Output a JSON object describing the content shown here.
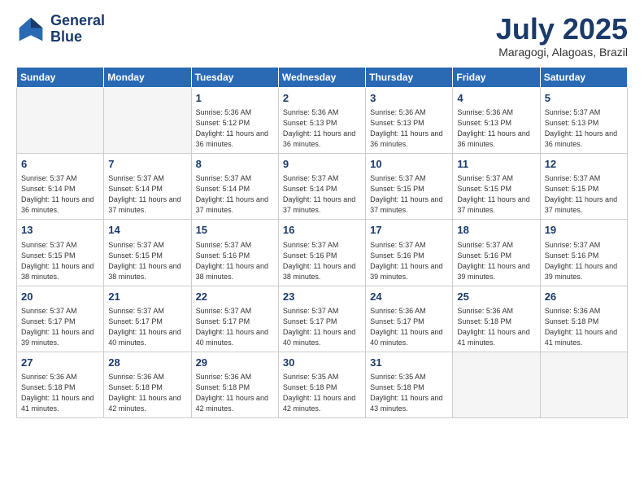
{
  "header": {
    "logo_line1": "General",
    "logo_line2": "Blue",
    "month": "July 2025",
    "location": "Maragogi, Alagoas, Brazil"
  },
  "weekdays": [
    "Sunday",
    "Monday",
    "Tuesday",
    "Wednesday",
    "Thursday",
    "Friday",
    "Saturday"
  ],
  "weeks": [
    [
      {
        "day": "",
        "info": ""
      },
      {
        "day": "",
        "info": ""
      },
      {
        "day": "1",
        "info": "Sunrise: 5:36 AM\nSunset: 5:12 PM\nDaylight: 11 hours and 36 minutes."
      },
      {
        "day": "2",
        "info": "Sunrise: 5:36 AM\nSunset: 5:13 PM\nDaylight: 11 hours and 36 minutes."
      },
      {
        "day": "3",
        "info": "Sunrise: 5:36 AM\nSunset: 5:13 PM\nDaylight: 11 hours and 36 minutes."
      },
      {
        "day": "4",
        "info": "Sunrise: 5:36 AM\nSunset: 5:13 PM\nDaylight: 11 hours and 36 minutes."
      },
      {
        "day": "5",
        "info": "Sunrise: 5:37 AM\nSunset: 5:13 PM\nDaylight: 11 hours and 36 minutes."
      }
    ],
    [
      {
        "day": "6",
        "info": "Sunrise: 5:37 AM\nSunset: 5:14 PM\nDaylight: 11 hours and 36 minutes."
      },
      {
        "day": "7",
        "info": "Sunrise: 5:37 AM\nSunset: 5:14 PM\nDaylight: 11 hours and 37 minutes."
      },
      {
        "day": "8",
        "info": "Sunrise: 5:37 AM\nSunset: 5:14 PM\nDaylight: 11 hours and 37 minutes."
      },
      {
        "day": "9",
        "info": "Sunrise: 5:37 AM\nSunset: 5:14 PM\nDaylight: 11 hours and 37 minutes."
      },
      {
        "day": "10",
        "info": "Sunrise: 5:37 AM\nSunset: 5:15 PM\nDaylight: 11 hours and 37 minutes."
      },
      {
        "day": "11",
        "info": "Sunrise: 5:37 AM\nSunset: 5:15 PM\nDaylight: 11 hours and 37 minutes."
      },
      {
        "day": "12",
        "info": "Sunrise: 5:37 AM\nSunset: 5:15 PM\nDaylight: 11 hours and 37 minutes."
      }
    ],
    [
      {
        "day": "13",
        "info": "Sunrise: 5:37 AM\nSunset: 5:15 PM\nDaylight: 11 hours and 38 minutes."
      },
      {
        "day": "14",
        "info": "Sunrise: 5:37 AM\nSunset: 5:15 PM\nDaylight: 11 hours and 38 minutes."
      },
      {
        "day": "15",
        "info": "Sunrise: 5:37 AM\nSunset: 5:16 PM\nDaylight: 11 hours and 38 minutes."
      },
      {
        "day": "16",
        "info": "Sunrise: 5:37 AM\nSunset: 5:16 PM\nDaylight: 11 hours and 38 minutes."
      },
      {
        "day": "17",
        "info": "Sunrise: 5:37 AM\nSunset: 5:16 PM\nDaylight: 11 hours and 39 minutes."
      },
      {
        "day": "18",
        "info": "Sunrise: 5:37 AM\nSunset: 5:16 PM\nDaylight: 11 hours and 39 minutes."
      },
      {
        "day": "19",
        "info": "Sunrise: 5:37 AM\nSunset: 5:16 PM\nDaylight: 11 hours and 39 minutes."
      }
    ],
    [
      {
        "day": "20",
        "info": "Sunrise: 5:37 AM\nSunset: 5:17 PM\nDaylight: 11 hours and 39 minutes."
      },
      {
        "day": "21",
        "info": "Sunrise: 5:37 AM\nSunset: 5:17 PM\nDaylight: 11 hours and 40 minutes."
      },
      {
        "day": "22",
        "info": "Sunrise: 5:37 AM\nSunset: 5:17 PM\nDaylight: 11 hours and 40 minutes."
      },
      {
        "day": "23",
        "info": "Sunrise: 5:37 AM\nSunset: 5:17 PM\nDaylight: 11 hours and 40 minutes."
      },
      {
        "day": "24",
        "info": "Sunrise: 5:36 AM\nSunset: 5:17 PM\nDaylight: 11 hours and 40 minutes."
      },
      {
        "day": "25",
        "info": "Sunrise: 5:36 AM\nSunset: 5:18 PM\nDaylight: 11 hours and 41 minutes."
      },
      {
        "day": "26",
        "info": "Sunrise: 5:36 AM\nSunset: 5:18 PM\nDaylight: 11 hours and 41 minutes."
      }
    ],
    [
      {
        "day": "27",
        "info": "Sunrise: 5:36 AM\nSunset: 5:18 PM\nDaylight: 11 hours and 41 minutes."
      },
      {
        "day": "28",
        "info": "Sunrise: 5:36 AM\nSunset: 5:18 PM\nDaylight: 11 hours and 42 minutes."
      },
      {
        "day": "29",
        "info": "Sunrise: 5:36 AM\nSunset: 5:18 PM\nDaylight: 11 hours and 42 minutes."
      },
      {
        "day": "30",
        "info": "Sunrise: 5:35 AM\nSunset: 5:18 PM\nDaylight: 11 hours and 42 minutes."
      },
      {
        "day": "31",
        "info": "Sunrise: 5:35 AM\nSunset: 5:18 PM\nDaylight: 11 hours and 43 minutes."
      },
      {
        "day": "",
        "info": ""
      },
      {
        "day": "",
        "info": ""
      }
    ]
  ]
}
